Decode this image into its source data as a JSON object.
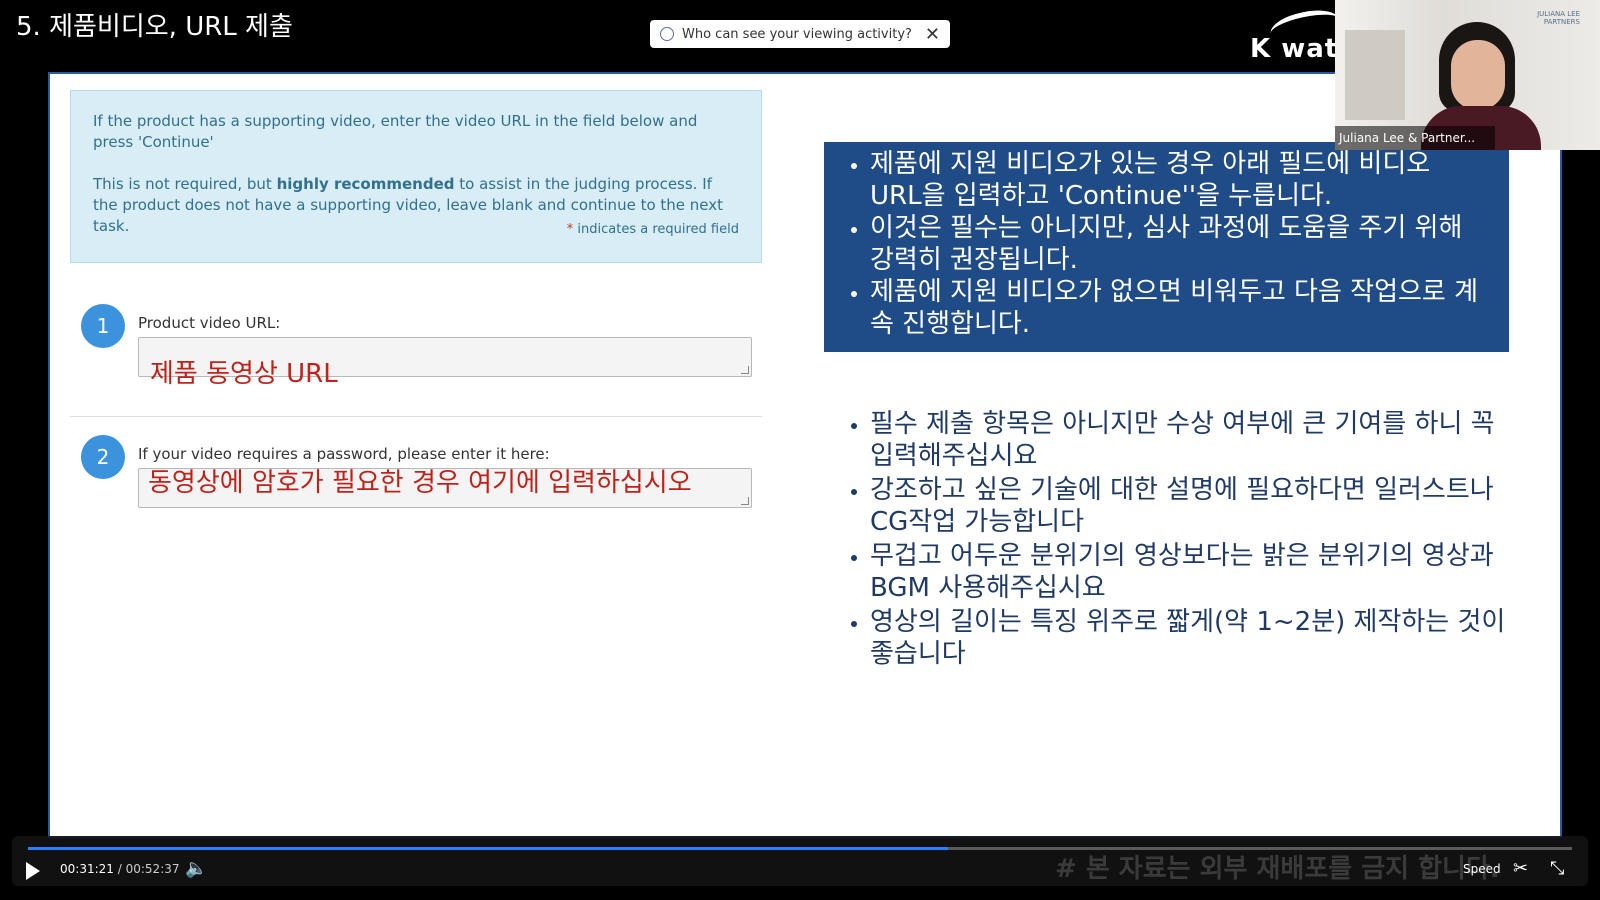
{
  "header": {
    "slide_title": "5. 제품비디오, URL 제출",
    "brand": "K wate"
  },
  "privacy_banner": {
    "text": "Who can see your viewing activity?",
    "close_icon": "close-icon"
  },
  "form": {
    "info_paragraph_1": "If the product has a supporting video, enter the video URL in the field below and press 'Continue'",
    "info_paragraph_2_pre": "This is not required, but ",
    "info_paragraph_2_bold": "highly recommended",
    "info_paragraph_2_post": " to assist in the judging process. If the product does not have a supporting video, leave blank and continue to the next task.",
    "required_star": "*",
    "required_note": "indicates a required field",
    "step1_number": "1",
    "step1_label": "Product video URL:",
    "step1_overlay": "제품 동영상 URL",
    "step2_number": "2",
    "step2_label": "If your video requires a password, please enter it here:",
    "step2_overlay": "동영상에 암호가 필요한 경우 여기에 입력하십시오"
  },
  "blue_box": {
    "items": [
      "제품에 지원 비디오가 있는 경우 아래 필드에 비디오 URL을 입력하고 'Continue''을 누릅니다.",
      "이것은 필수는 아니지만, 심사 과정에 도움을 주기 위해 강력히 권장됩니다.",
      "제품에 지원 비디오가 없으면 비워두고 다음 작업으로 계속 진행합니다."
    ]
  },
  "notes": {
    "items": [
      "필수 제출 항목은 아니지만 수상 여부에 큰 기여를 하니 꼭 입력해주십시요",
      "강조하고 싶은 기술에 대한 설명에 필요하다면 일러스트나 CG작업 가능합니다",
      "무겁고 어두운 분위기의 영상보다는 밝은 분위기의 영상과 BGM 사용해주십시요",
      "영상의 길이는 특징 위주로 짧게(약 1~2분) 제작하는 것이 좋습니다"
    ]
  },
  "webcam": {
    "name": "Juliana Lee & Partner...",
    "logo_line1": "JULIANA LEE",
    "logo_line2": "PARTNERS"
  },
  "watermark": "# 본 자료는 외부 재배포를 금지 합니다.",
  "player": {
    "current_time": "00:31:21",
    "separator": "/",
    "duration": "00:52:37",
    "progress_fraction": 0.596,
    "speed_label": "Speed",
    "play_icon": "play-icon",
    "volume_icon": "volume-icon",
    "scissors_icon": "scissors-icon",
    "exit_fullscreen_icon": "exit-fullscreen-icon",
    "accent_color": "#2a7fff"
  }
}
